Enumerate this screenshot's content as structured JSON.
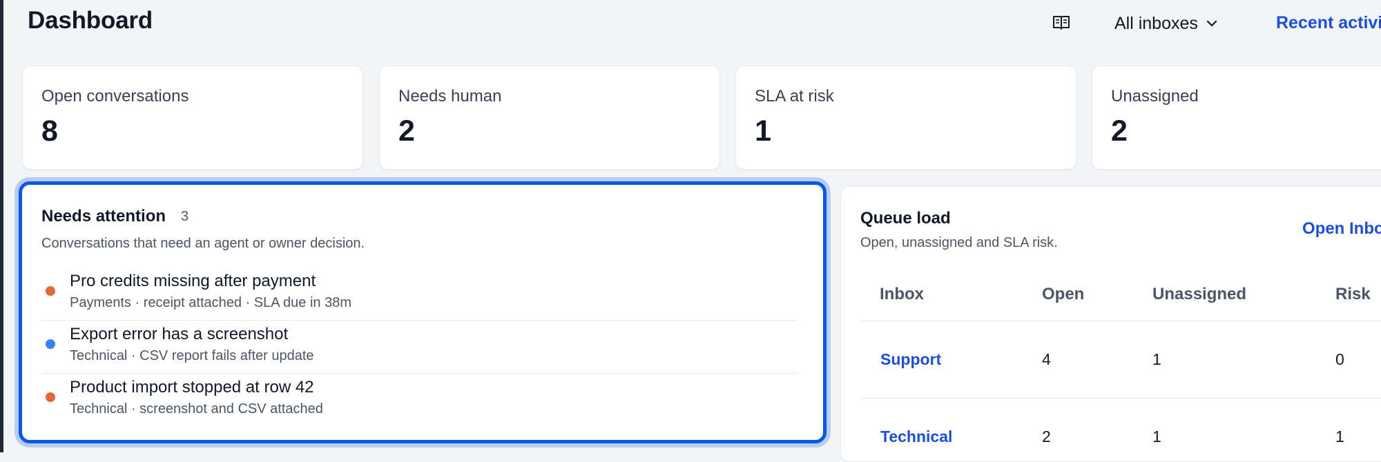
{
  "header": {
    "title": "Dashboard",
    "inbox_filter": "All inboxes",
    "recent_activity": "Recent activity"
  },
  "stats": [
    {
      "label": "Open conversations",
      "value": "8"
    },
    {
      "label": "Needs human",
      "value": "2"
    },
    {
      "label": "SLA at risk",
      "value": "1"
    },
    {
      "label": "Unassigned",
      "value": "2"
    }
  ],
  "needs_attention": {
    "title": "Needs attention",
    "count": "3",
    "subtitle": "Conversations that need an agent or owner decision.",
    "items": [
      {
        "title": "Pro credits missing after payment",
        "meta": "Payments · receipt attached · SLA due in 38m",
        "dot_color": "#e2683c"
      },
      {
        "title": "Export error has a screenshot",
        "meta": "Technical · CSV report fails after update",
        "dot_color": "#3b82f6"
      },
      {
        "title": "Product import stopped at row 42",
        "meta": "Technical · screenshot and CSV attached",
        "dot_color": "#e2683c"
      }
    ]
  },
  "queue_load": {
    "title": "Queue load",
    "subtitle": "Open, unassigned and SLA risk.",
    "link": "Open Inbox",
    "columns": [
      "Inbox",
      "Open",
      "Unassigned",
      "Risk"
    ],
    "rows": [
      {
        "inbox": "Support",
        "open": "4",
        "unassigned": "1",
        "risk": "0"
      },
      {
        "inbox": "Technical",
        "open": "2",
        "unassigned": "1",
        "risk": "1"
      }
    ]
  },
  "colors": {
    "accent": "#0b57e3",
    "link": "#1d4ed8",
    "background": "#f3f4f6"
  }
}
